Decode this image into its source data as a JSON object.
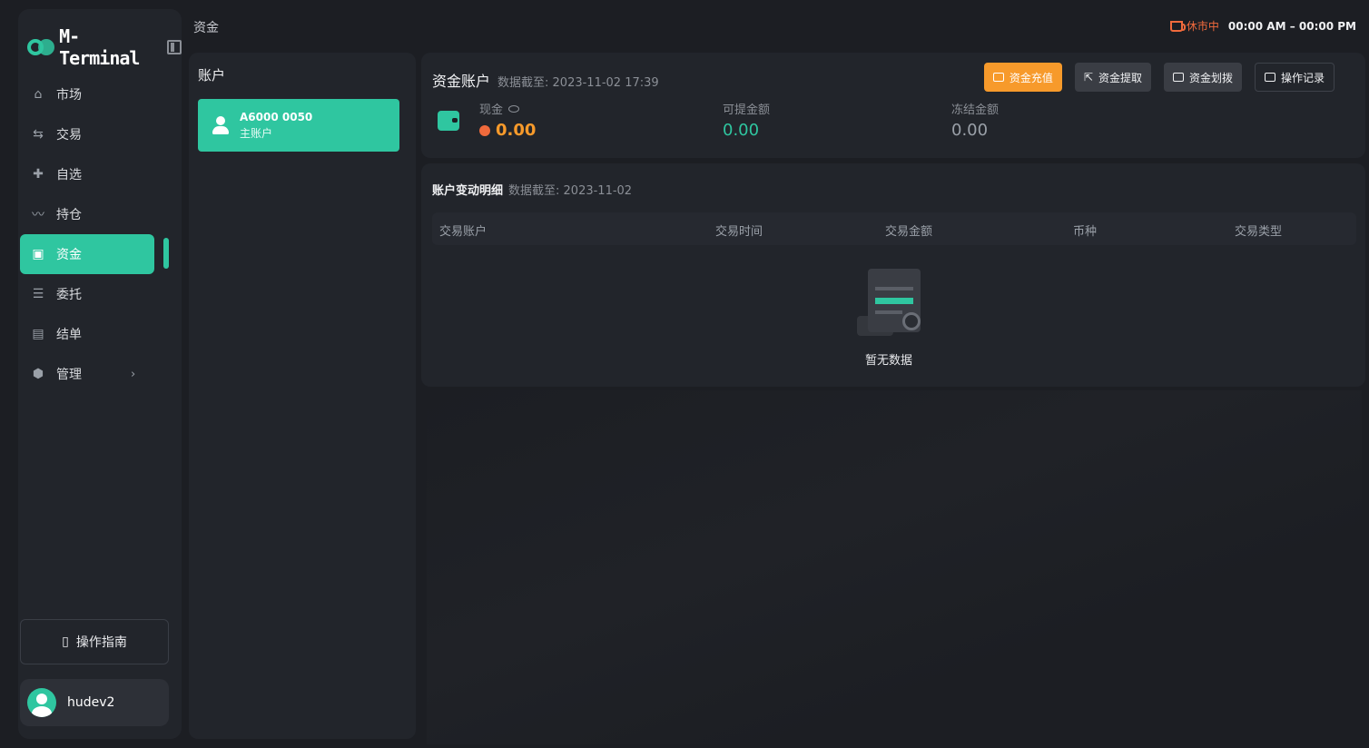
{
  "app": {
    "logo_text": "M-Terminal"
  },
  "topbar": {
    "breadcrumb": "资金",
    "market_status": "休市中",
    "market_hours": "00:00 AM – 00:00 PM"
  },
  "sidebar": {
    "items": [
      {
        "label": "市场",
        "icon": "market-icon"
      },
      {
        "label": "交易",
        "icon": "trade-icon"
      },
      {
        "label": "自选",
        "icon": "watchlist-icon"
      },
      {
        "label": "持仓",
        "icon": "position-icon"
      },
      {
        "label": "资金",
        "icon": "wallet-icon",
        "active": true
      },
      {
        "label": "委托",
        "icon": "orders-icon"
      },
      {
        "label": "结单",
        "icon": "statement-icon"
      },
      {
        "label": "管理",
        "icon": "manage-icon"
      }
    ],
    "guide_label": "操作指南",
    "username": "hudev2"
  },
  "accounts": {
    "title": "账户",
    "items": [
      {
        "id": "A6000 0050",
        "type": "主账户"
      }
    ]
  },
  "funds": {
    "title": "资金账户",
    "as_of": "数据截至: 2023-11-02 17:39",
    "actions": {
      "deposit": "资金充值",
      "withdraw": "资金提取",
      "transfer": "资金划拨",
      "records": "操作记录"
    },
    "cash_label": "现金",
    "cash_value": "0.00",
    "withdrawable_label": "可提金额",
    "withdrawable_value": "0.00",
    "frozen_label": "冻结金额",
    "frozen_value": "0.00"
  },
  "details": {
    "title": "账户变动明细",
    "as_of": "数据截至: 2023-11-02",
    "columns": [
      "交易账户",
      "交易时间",
      "交易金额",
      "币种",
      "交易类型"
    ],
    "rows": [],
    "empty_text": "暂无数据"
  },
  "colors": {
    "accent": "#2fc6a0",
    "warning": "#f79a2b",
    "market_closed": "#f06a3c",
    "background": "#1c1e23",
    "panel": "#22252b"
  }
}
